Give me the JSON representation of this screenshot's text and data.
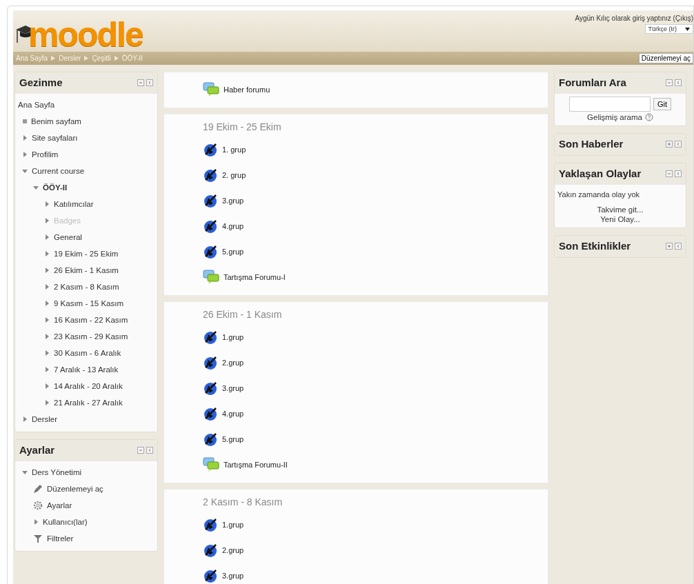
{
  "header": {
    "logo": "moodle",
    "login_text": "Aygün Kılıç olarak giriş yaptınız (",
    "logout_link": "Çıkış",
    "login_end": ")",
    "language": "Türkçe (tr)",
    "edit_button": "Düzenlemeyi aç"
  },
  "breadcrumb": [
    "Ana Sayfa",
    "Dersler",
    "Çeşitli",
    "ÖÖY-II"
  ],
  "left_blocks": [
    {
      "title": "Gezinme",
      "collapsed": false,
      "items": [
        {
          "label": "Ana Sayfa",
          "kind": "root"
        },
        {
          "label": "Benim sayfam",
          "kind": "leaf"
        },
        {
          "label": "Site sayfaları",
          "kind": "branch",
          "expanded": false
        },
        {
          "label": "Profilim",
          "kind": "branch",
          "expanded": false
        },
        {
          "label": "Current course",
          "kind": "branch",
          "expanded": true,
          "children": [
            {
              "label": "ÖÖY-II",
              "kind": "branch",
              "expanded": true,
              "bold": true,
              "children": [
                {
                  "label": "Katılımcılar",
                  "kind": "branch",
                  "expanded": false
                },
                {
                  "label": "Badges",
                  "kind": "branch",
                  "expanded": false,
                  "disabled": true
                },
                {
                  "label": "General",
                  "kind": "branch",
                  "expanded": false
                },
                {
                  "label": "19 Ekim - 25 Ekim",
                  "kind": "branch",
                  "expanded": false
                },
                {
                  "label": "26 Ekim - 1 Kasım",
                  "kind": "branch",
                  "expanded": false
                },
                {
                  "label": "2 Kasım - 8 Kasım",
                  "kind": "branch",
                  "expanded": false
                },
                {
                  "label": "9 Kasım - 15 Kasım",
                  "kind": "branch",
                  "expanded": false
                },
                {
                  "label": "16 Kasım - 22 Kasım",
                  "kind": "branch",
                  "expanded": false
                },
                {
                  "label": "23 Kasım - 29 Kasım",
                  "kind": "branch",
                  "expanded": false
                },
                {
                  "label": "30 Kasım - 6 Aralık",
                  "kind": "branch",
                  "expanded": false
                },
                {
                  "label": "7 Aralık - 13 Aralık",
                  "kind": "branch",
                  "expanded": false
                },
                {
                  "label": "14 Aralık - 20 Aralık",
                  "kind": "branch",
                  "expanded": false
                },
                {
                  "label": "21 Aralık - 27 Aralık",
                  "kind": "branch",
                  "expanded": false
                }
              ]
            }
          ]
        },
        {
          "label": "Dersler",
          "kind": "branch",
          "expanded": false
        }
      ]
    },
    {
      "title": "Ayarlar",
      "collapsed": false,
      "items": [
        {
          "label": "Ders Yönetimi",
          "kind": "branch",
          "expanded": true,
          "children": [
            {
              "label": "Düzenlemeyi aç",
              "kind": "edit"
            },
            {
              "label": "Ayarlar",
              "kind": "settings"
            },
            {
              "label": "Kullanıcı(lar)",
              "kind": "branch",
              "expanded": false
            },
            {
              "label": "Filtreler",
              "kind": "filter"
            }
          ]
        }
      ]
    }
  ],
  "sections": [
    {
      "activities": [
        {
          "kind": "forum",
          "label": "Haber forumu"
        }
      ]
    },
    {
      "title": "19 Ekim - 25 Ekim",
      "activities": [
        {
          "kind": "group",
          "label": "1. grup"
        },
        {
          "kind": "group",
          "label": "2. grup"
        },
        {
          "kind": "group",
          "label": "3.grup"
        },
        {
          "kind": "group",
          "label": "4.grup"
        },
        {
          "kind": "group",
          "label": "5.grup"
        },
        {
          "kind": "forum",
          "label": "Tartışma Forumu-I"
        }
      ]
    },
    {
      "title": "26 Ekim - 1 Kasım",
      "activities": [
        {
          "kind": "group",
          "label": "1.grup"
        },
        {
          "kind": "group",
          "label": "2.grup"
        },
        {
          "kind": "group",
          "label": "3.grup"
        },
        {
          "kind": "group",
          "label": "4.grup"
        },
        {
          "kind": "group",
          "label": "5.grup"
        },
        {
          "kind": "forum",
          "label": "Tartışma Forumu-II"
        }
      ]
    },
    {
      "title": "2 Kasım - 8 Kasım",
      "activities": [
        {
          "kind": "group",
          "label": "1.grup"
        },
        {
          "kind": "group",
          "label": "2.grup"
        },
        {
          "kind": "group",
          "label": "3.grup"
        }
      ]
    }
  ],
  "right_blocks": [
    {
      "kind": "search",
      "title": "Forumları Ara",
      "collapsed": false,
      "button": "Git",
      "link": "Gelişmiş arama"
    },
    {
      "title": "Son Haberler",
      "collapsed": true
    },
    {
      "kind": "events",
      "title": "Yaklaşan Olaylar",
      "collapsed": false,
      "text": "Yakın zamanda olay yok",
      "links": [
        "Takvime git...",
        "Yeni Olay..."
      ]
    },
    {
      "title": "Son Etkinlikler",
      "collapsed": true
    }
  ]
}
